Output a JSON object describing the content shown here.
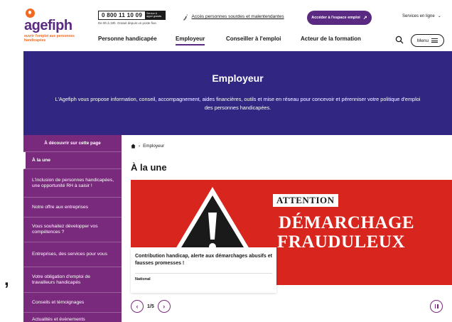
{
  "header": {
    "logo": {
      "name": "agefiph",
      "tagline": "ouvrir l'emploi aux personnes handicapées"
    },
    "phone": {
      "number": "0 800 11 10 09",
      "badge": "Service & appel gratuits",
      "hours": "De 9h à 18h. Gratuit depuis un poste fixe."
    },
    "accessibility_link": "Accès personnes sourdes et malentendantes",
    "cta_label": "Accéder à l'espace emploi",
    "services_label": "Services en ligne",
    "nav": [
      "Personne handicapée",
      "Employeur",
      "Conseiller à l'emploi",
      "Acteur de la formation"
    ],
    "menu_label": "Menu"
  },
  "hero": {
    "title": "Employeur",
    "text": "L'Agefiph vous propose information, conseil, accompagnement, aides financières, outils et mise en réseau pour concevoir et pérenniser votre politique d'emploi des personnes handicapées."
  },
  "sidebar": {
    "heading": "À découvrir sur cette page",
    "items": [
      "À la une",
      "L'inclusion de personnes handicapées, une opportunité RH à saisir !",
      "Notre offre aux entreprises",
      "Vous souhaitez développer vos compétences ?",
      "Entreprises, des services pour vous",
      "Votre obligation d'emploi de travailleurs handicapés",
      "Conseils et témoignages",
      "Actualités et évènements"
    ]
  },
  "main": {
    "breadcrumb": "Employeur",
    "section_title": "À la une",
    "slide": {
      "banner_attention": "ATTENTION",
      "banner_line1": "DÉMARCHAGE",
      "banner_line2": "FRAUDULEUX",
      "card_title": "Contribution handicap, alerte aux démarchages abusifs et fausses promesses !",
      "card_tag": "National"
    },
    "pager": {
      "current": "1/5"
    }
  },
  "stray_glyph": ",",
  "colors": {
    "purple": "#5a2a82",
    "sidebar": "#7a2a7d",
    "hero": "#312783",
    "orange": "#f26a21",
    "banner_red": "#d8261f"
  }
}
